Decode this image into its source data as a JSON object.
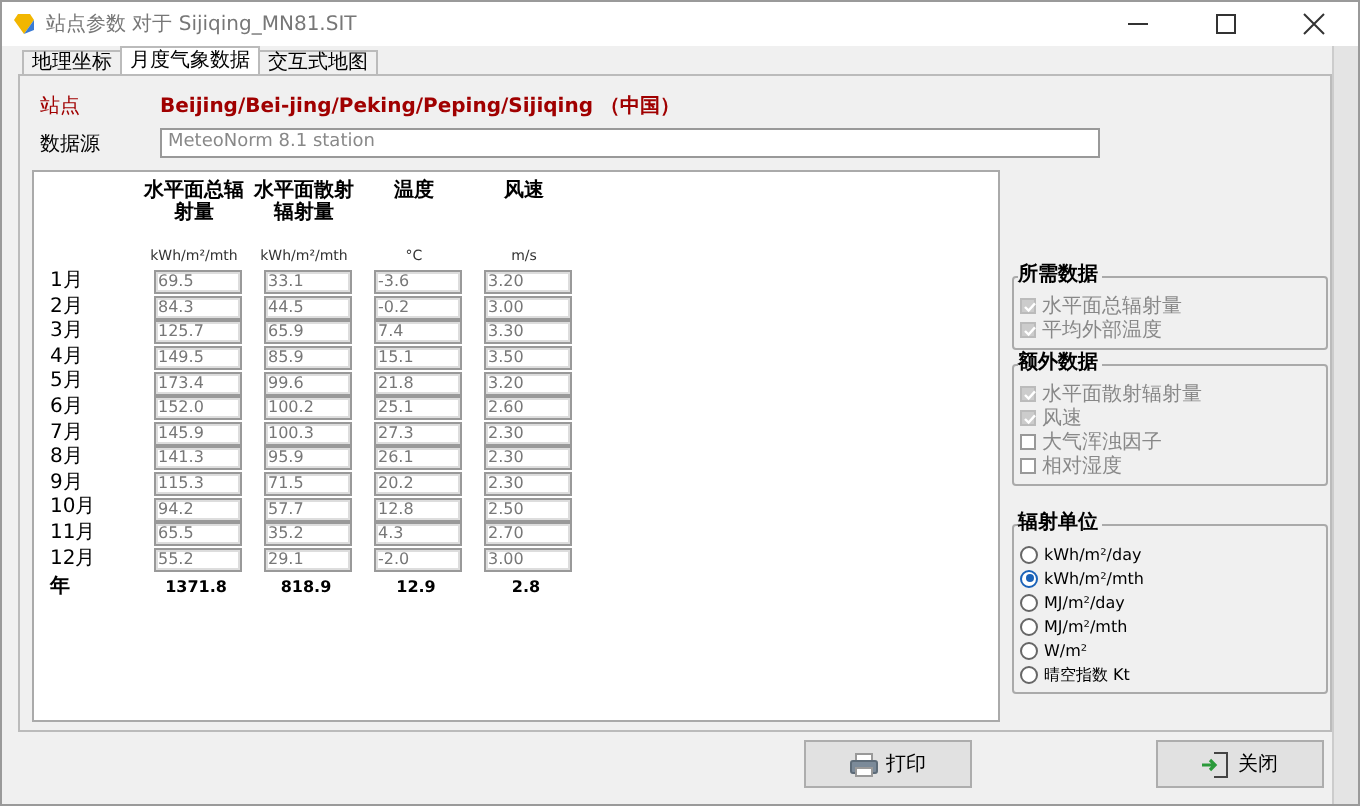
{
  "window": {
    "title": "站点参数 对于 Sijiqing_MN81.SIT"
  },
  "tabs": [
    {
      "label": "地理坐标",
      "selected": false
    },
    {
      "label": "月度气象数据",
      "selected": true
    },
    {
      "label": "交互式地图",
      "selected": false
    }
  ],
  "site": {
    "label": "站点",
    "value": "Beijing/Bei-jing/Peking/Peping/Sijiqing （中国）"
  },
  "data_source": {
    "label": "数据源",
    "value": "MeteoNorm 8.1 station"
  },
  "table": {
    "columns": [
      {
        "header": "水平面总辐射量",
        "unit": "kWh/m²/mth"
      },
      {
        "header": "水平面散射辐射量",
        "unit": "kWh/m²/mth"
      },
      {
        "header": "温度",
        "unit": "°C"
      },
      {
        "header": "风速",
        "unit": "m/s"
      }
    ],
    "rows": [
      {
        "month": "1月",
        "values": [
          "69.5",
          "33.1",
          "-3.6",
          "3.20"
        ]
      },
      {
        "month": "2月",
        "values": [
          "84.3",
          "44.5",
          "-0.2",
          "3.00"
        ]
      },
      {
        "month": "3月",
        "values": [
          "125.7",
          "65.9",
          "7.4",
          "3.30"
        ]
      },
      {
        "month": "4月",
        "values": [
          "149.5",
          "85.9",
          "15.1",
          "3.50"
        ]
      },
      {
        "month": "5月",
        "values": [
          "173.4",
          "99.6",
          "21.8",
          "3.20"
        ]
      },
      {
        "month": "6月",
        "values": [
          "152.0",
          "100.2",
          "25.1",
          "2.60"
        ]
      },
      {
        "month": "7月",
        "values": [
          "145.9",
          "100.3",
          "27.3",
          "2.30"
        ]
      },
      {
        "month": "8月",
        "values": [
          "141.3",
          "95.9",
          "26.1",
          "2.30"
        ]
      },
      {
        "month": "9月",
        "values": [
          "115.3",
          "71.5",
          "20.2",
          "2.30"
        ]
      },
      {
        "month": "10月",
        "values": [
          "94.2",
          "57.7",
          "12.8",
          "2.50"
        ]
      },
      {
        "month": "11月",
        "values": [
          "65.5",
          "35.2",
          "4.3",
          "2.70"
        ]
      },
      {
        "month": "12月",
        "values": [
          "55.2",
          "29.1",
          "-2.0",
          "3.00"
        ]
      }
    ],
    "total": {
      "label": "年",
      "values": [
        "1371.8",
        "818.9",
        "12.9",
        "2.8"
      ]
    }
  },
  "groups": [
    {
      "title": "所需数据",
      "items": [
        {
          "label": "水平面总辐射量",
          "checked": true,
          "disabled": true
        },
        {
          "label": "平均外部温度",
          "checked": true,
          "disabled": true
        }
      ]
    },
    {
      "title": "额外数据",
      "items": [
        {
          "label": "水平面散射辐射量",
          "checked": true,
          "disabled": true
        },
        {
          "label": "风速",
          "checked": true,
          "disabled": true
        },
        {
          "label": "大气浑浊因子",
          "checked": false,
          "disabled": true
        },
        {
          "label": "相对湿度",
          "checked": false,
          "disabled": true
        }
      ]
    }
  ],
  "units": {
    "title": "辐射单位",
    "options": [
      {
        "label": "kWh/m²/day",
        "selected": false
      },
      {
        "label": "kWh/m²/mth",
        "selected": true
      },
      {
        "label": "MJ/m²/day",
        "selected": false
      },
      {
        "label": "MJ/m²/mth",
        "selected": false
      },
      {
        "label": "W/m²",
        "selected": false
      },
      {
        "label": "晴空指数 Kt",
        "selected": false
      }
    ]
  },
  "buttons": [
    {
      "label": "打印",
      "kind": "print"
    },
    {
      "label": "关闭",
      "kind": "close"
    }
  ]
}
